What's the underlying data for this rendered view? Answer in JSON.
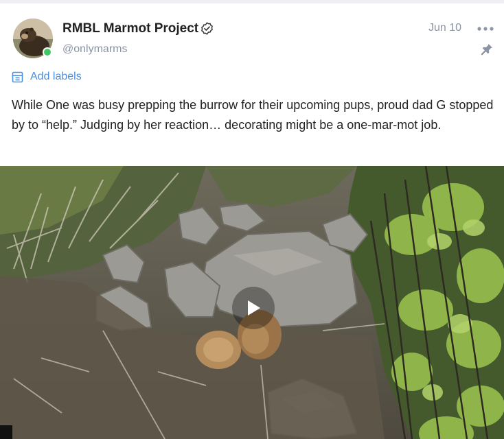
{
  "post": {
    "author": {
      "display_name": "RMBL Marmot Project",
      "handle": "@onlymarms",
      "verified": true,
      "online": true
    },
    "date": "Jun 10",
    "labels_action": "Add labels",
    "text": "While One was busy prepping the burrow for their upcoming pups, proud dad G stopped by to “help.” Judging by her reaction… decorating might be a one-mar-mot job.",
    "media": {
      "type": "video",
      "description_icon": "play-icon"
    }
  },
  "icons": {
    "verified": "verified-badge-icon",
    "more": "more-dots-icon",
    "pin": "pin-icon",
    "labels": "label-icon"
  },
  "colors": {
    "accent": "#4a8fe0",
    "muted": "#8a94a4",
    "online": "#43c665"
  }
}
